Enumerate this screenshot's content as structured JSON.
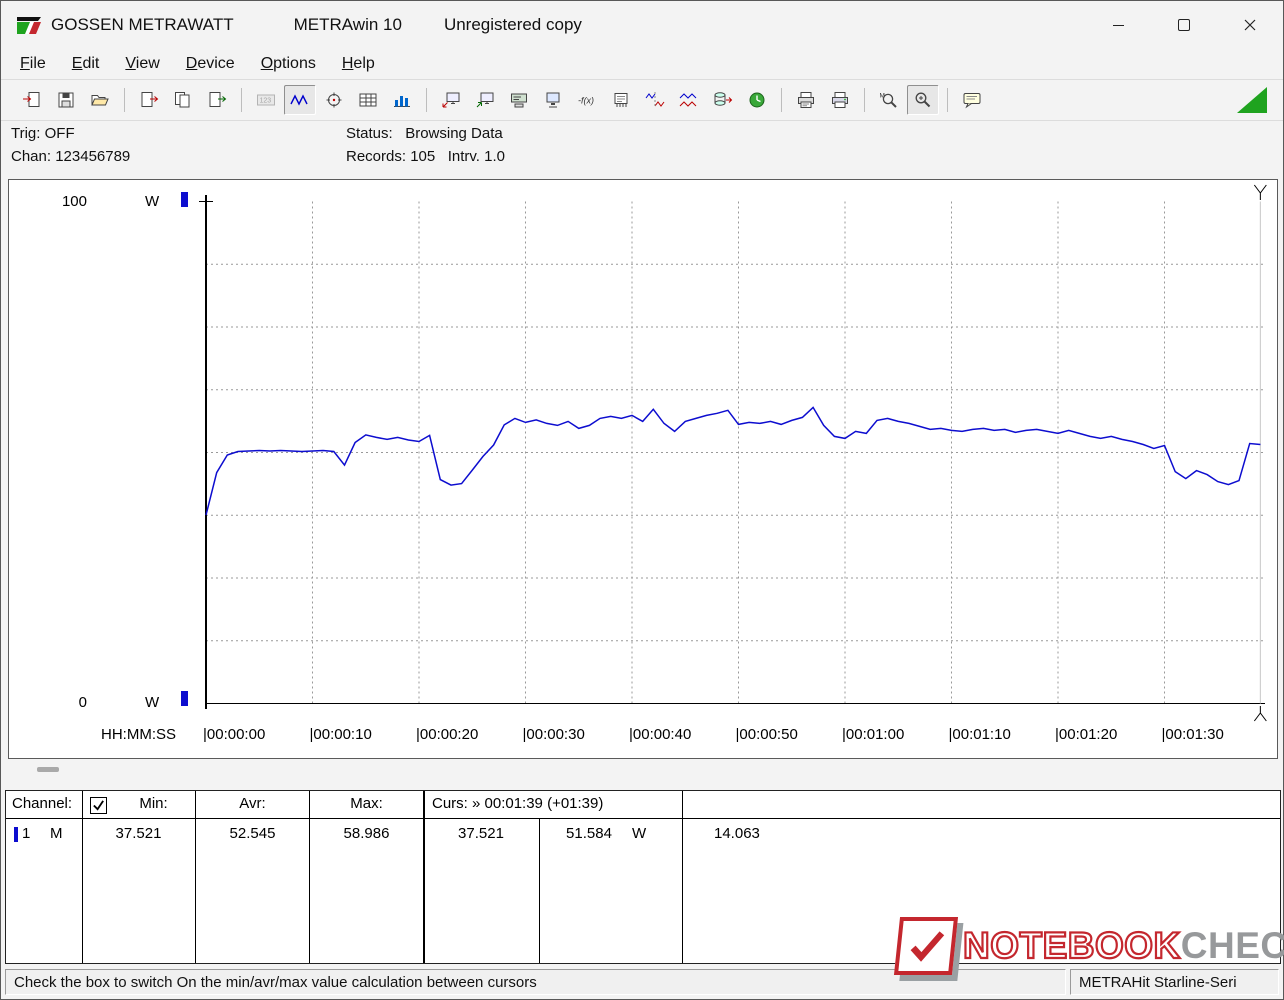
{
  "window": {
    "app_title": "GOSSEN METRAWATT",
    "doc_title": "METRAwin 10",
    "license_note": "Unregistered copy"
  },
  "menu": {
    "items": [
      "File",
      "Edit",
      "View",
      "Device",
      "Options",
      "Help"
    ]
  },
  "toolbar": {
    "groups": [
      [
        {
          "name": "import-file",
          "icon": "docArrowIn"
        },
        {
          "name": "save-file",
          "icon": "floppy"
        },
        {
          "name": "open-file",
          "icon": "folderOpen"
        }
      ],
      [
        {
          "name": "copy-chart",
          "icon": "docArrowOut"
        },
        {
          "name": "copy-data",
          "icon": "docCopy"
        },
        {
          "name": "export-file",
          "icon": "docArrowOut2"
        }
      ],
      [
        {
          "name": "view-digital-display",
          "icon": "displayLCD",
          "state": "disabled"
        },
        {
          "name": "view-curve-chart",
          "icon": "wave",
          "state": "pressed"
        },
        {
          "name": "view-analog-meter",
          "icon": "gauge"
        },
        {
          "name": "view-data-table",
          "icon": "tableIcon"
        },
        {
          "name": "view-histogram",
          "icon": "barsIcon"
        }
      ],
      [
        {
          "name": "device-read",
          "icon": "monitorArrowR"
        },
        {
          "name": "device-read-memory",
          "icon": "monitorArrowG"
        },
        {
          "name": "device-display-config",
          "icon": "displayCfg"
        },
        {
          "name": "pc-online-monitor",
          "icon": "pcMonitor"
        },
        {
          "name": "formula",
          "icon": "fxIcon"
        },
        {
          "name": "device-monitor",
          "icon": "deviceMem"
        },
        {
          "name": "channel-split",
          "icon": "splitWave"
        },
        {
          "name": "channel-pair",
          "icon": "wavePair"
        },
        {
          "name": "export-database",
          "icon": "dbExport"
        },
        {
          "name": "interval-timer",
          "icon": "clockGreen"
        }
      ],
      [
        {
          "name": "print-preview",
          "icon": "printPreview"
        },
        {
          "name": "print",
          "icon": "printer"
        }
      ],
      [
        {
          "name": "zoom-mode",
          "icon": "zoomM"
        },
        {
          "name": "zoom-in",
          "icon": "zoomPlain",
          "state": "pressed"
        }
      ],
      [
        {
          "name": "annotation",
          "icon": "noteIcon"
        }
      ]
    ]
  },
  "info_panel": {
    "trig": "Trig: OFF",
    "chan": "Chan: 123456789",
    "status": "Status:   Browsing Data",
    "records": "Records: 105   Intrv. 1.0"
  },
  "chart_data": {
    "type": "line",
    "title": "",
    "unit": "W",
    "y_top_label": "100",
    "y_bottom_label": "0",
    "ylim": [
      0,
      100
    ],
    "y_divisions": 8,
    "x_axis_label": "HH:MM:SS",
    "x_ticks": [
      "00:00:00",
      "00:00:10",
      "00:00:20",
      "00:00:30",
      "00:00:40",
      "00:00:50",
      "00:01:00",
      "00:01:10",
      "00:01:20",
      "00:01:30"
    ],
    "x_tick_interval_s": 10,
    "grid": "dashed",
    "records": 105,
    "sample_interval_s": 1.0,
    "series": [
      {
        "name": "Channel 1 power (W)",
        "color": "#0d0dcf",
        "start_time_s": 0,
        "values": [
          37.521,
          46.0,
          49.5,
          50.2,
          50.3,
          50.4,
          50.3,
          50.4,
          50.3,
          50.2,
          50.3,
          50.4,
          50.2,
          47.5,
          52.0,
          53.5,
          53.0,
          52.6,
          53.0,
          52.5,
          52.2,
          53.4,
          44.6,
          43.5,
          43.8,
          46.5,
          49.2,
          51.5,
          55.5,
          56.8,
          56.0,
          56.5,
          55.8,
          55.4,
          56.2,
          54.8,
          55.4,
          56.8,
          57.2,
          56.8,
          57.4,
          56.2,
          58.6,
          55.8,
          54.2,
          56.2,
          56.8,
          57.4,
          57.8,
          58.4,
          55.6,
          56.0,
          55.8,
          56.2,
          55.6,
          56.4,
          57.0,
          58.986,
          55.4,
          53.2,
          52.8,
          54.2,
          53.8,
          56.4,
          56.8,
          56.2,
          55.8,
          55.2,
          54.6,
          54.8,
          54.4,
          54.2,
          54.6,
          54.8,
          54.4,
          54.6,
          54.0,
          54.4,
          54.6,
          54.2,
          53.8,
          54.4,
          53.8,
          53.2,
          52.8,
          53.2,
          52.6,
          52.2,
          51.6,
          50.8,
          51.4,
          46.2,
          44.8,
          46.4,
          45.6,
          44.2,
          43.6,
          44.4,
          51.8,
          51.584
        ]
      }
    ],
    "stats": {
      "min": 37.521,
      "avr": 52.545,
      "max": 58.986
    },
    "cursor": {
      "time": "00:01:39",
      "relative": "+01:39",
      "value_cursor1": 37.521,
      "value_cursor2": 51.584,
      "delta": 14.063
    }
  },
  "channel_table": {
    "headers": {
      "channel": "Channel:",
      "min": "Min:",
      "avr": "Avr:",
      "max": "Max:",
      "cursor": "Curs: » 00:01:39 (+01:39)"
    },
    "checkbox_checked": true,
    "row": {
      "channel": "1",
      "mode": "M",
      "min": "37.521",
      "avr": "52.545",
      "max": "58.986",
      "cursor1": "37.521",
      "cursor2": "51.584",
      "unit": "W",
      "delta": "14.063"
    }
  },
  "watermark": {
    "part1": "NOTEBOOK",
    "part2": "CHECK"
  },
  "status_bar": {
    "left": "Check the box to switch On the min/avr/max value calculation between cursors",
    "right": "METRAHit Starline-Seri"
  }
}
